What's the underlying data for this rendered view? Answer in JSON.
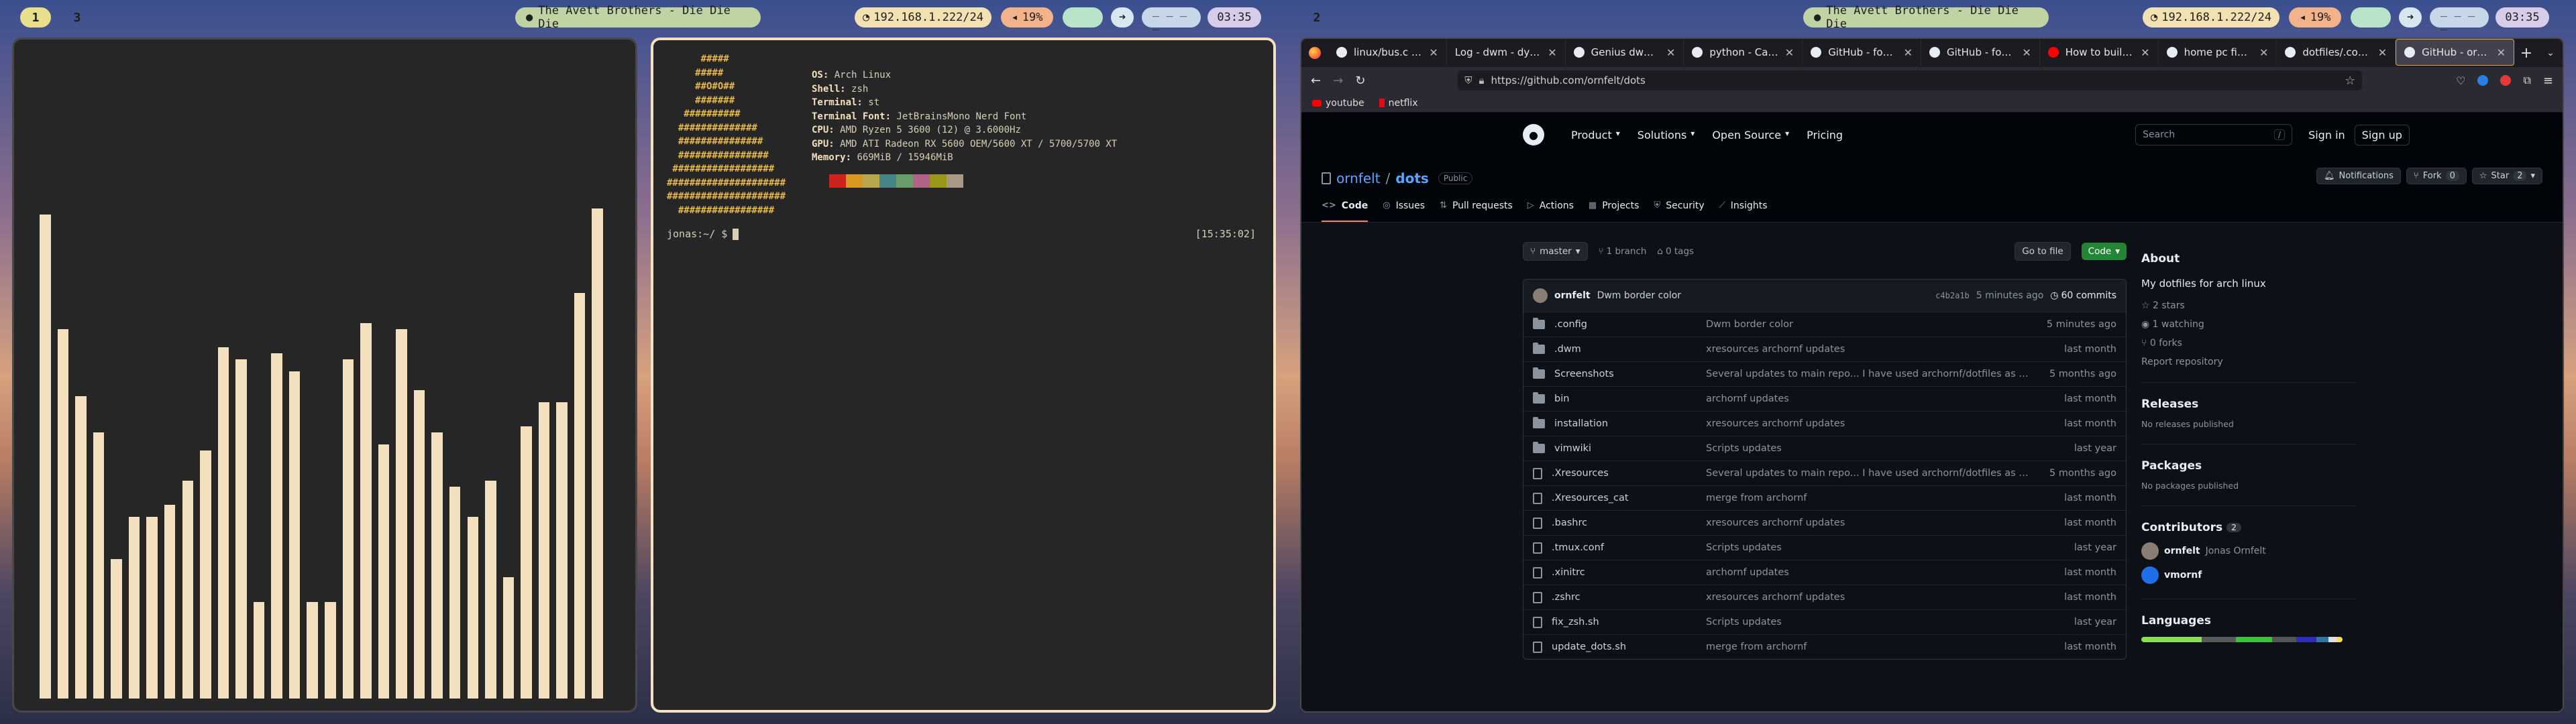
{
  "left_bar": {
    "tags": [
      "1",
      "3"
    ],
    "song": "The Avett Brothers - Die Die Die",
    "ip": "192.168.1.222/24",
    "volume": "19%",
    "dots": "_ _ _ _",
    "time": "03:35"
  },
  "right_bar": {
    "tags": [
      "2"
    ],
    "song": "The Avett Brothers - Die Die Die",
    "ip": "192.168.1.222/24",
    "volume": "19%",
    "dots": "_ _ _ _",
    "time": "03:35"
  },
  "visualizer": {
    "levels": [
      0.8,
      0.61,
      0.5,
      0.44,
      0.23,
      0.3,
      0.3,
      0.32,
      0.36,
      0.41,
      0.58,
      0.56,
      0.16,
      0.57,
      0.54,
      0.16,
      0.16,
      0.56,
      0.62,
      0.42,
      0.61,
      0.51,
      0.44,
      0.35,
      0.3,
      0.36,
      0.2,
      0.45,
      0.49,
      0.49,
      0.67,
      0.81
    ],
    "bar_color": "#f3e0bf"
  },
  "terminal": {
    "logo": [
      "      #####",
      "     #####",
      "     ##O#O##",
      "     #######",
      "   ##########",
      "  ##############",
      "  ###############",
      "  ################",
      " ##################",
      "#####################",
      "#####################",
      "  #################"
    ],
    "info": [
      {
        "key": "OS:",
        "val": "Arch Linux"
      },
      {
        "key": "Shell:",
        "val": "zsh"
      },
      {
        "key": "Terminal:",
        "val": "st"
      },
      {
        "key": "Terminal Font:",
        "val": "JetBrainsMono Nerd Font"
      },
      {
        "key": "CPU:",
        "val": "AMD Ryzen 5 3600 (12) @ 3.6000Hz"
      },
      {
        "key": "GPU:",
        "val": "AMD ATI Radeon RX 5600 OEM/5600 XT / 5700/5700 XT"
      },
      {
        "key": "Memory:",
        "val": "669MiB / 15946MiB"
      }
    ],
    "swatches": [
      "#cc241d",
      "#d79921",
      "#b8a64c",
      "#458588",
      "#689d6a",
      "#b16286",
      "#98971a",
      "#a89984"
    ],
    "prompt": "jonas:~/ $",
    "clock": "[15:35:02]"
  },
  "browser": {
    "tabs": [
      {
        "title": "linux/bus.c at main",
        "icon": "github-icon"
      },
      {
        "title": "Log - dwm - dynamic",
        "icon": "none"
      },
      {
        "title": "Genius dwm single",
        "icon": "github-icon"
      },
      {
        "title": "python - Calling a",
        "icon": "github-icon"
      },
      {
        "title": "GitHub - foglemon",
        "icon": "github-icon"
      },
      {
        "title": "GitHub - foglemon",
        "icon": "github-icon"
      },
      {
        "title": "How to build and",
        "icon": "youtube-icon"
      },
      {
        "title": "home pc fixes - on",
        "icon": "github-icon"
      },
      {
        "title": "dotfiles/.config at",
        "icon": "github-icon"
      },
      {
        "title": "GitHub - ornfelt/do",
        "icon": "github-icon"
      }
    ],
    "url": "https://github.com/ornfelt/dots",
    "bookmarks": [
      "youtube",
      "netflix"
    ]
  },
  "github": {
    "nav": [
      "Product",
      "Solutions",
      "Open Source",
      "Pricing"
    ],
    "search_placeholder": "Search",
    "search_key": "/",
    "sign_in": "Sign in",
    "sign_up": "Sign up",
    "owner": "ornfelt",
    "repo": "dots",
    "visibility": "Public",
    "notifications": "Notifications",
    "fork_label": "Fork",
    "fork_count": "0",
    "star_label": "Star",
    "star_count": "2",
    "repo_tabs": [
      "Code",
      "Issues",
      "Pull requests",
      "Actions",
      "Projects",
      "Security",
      "Insights"
    ],
    "branch": "master",
    "branch_count": "1 branch",
    "tag_count": "0 tags",
    "go_to_file": "Go to file",
    "code_button": "Code",
    "commit": {
      "author": "ornfelt",
      "message": "Dwm border color",
      "hash": "c4b2a1b",
      "time": "5 minutes ago",
      "count": "60 commits"
    },
    "files": [
      {
        "name": ".config",
        "type": "dir",
        "msg": "Dwm border color",
        "time": "5 minutes ago"
      },
      {
        "name": ".dwm",
        "type": "dir",
        "msg": "xresources archornf updates",
        "time": "last month"
      },
      {
        "name": "Screenshots",
        "type": "dir",
        "msg": "Several updates to main repo... I have used archornf/dotfiles as rep...",
        "time": "5 months ago"
      },
      {
        "name": "bin",
        "type": "dir",
        "msg": "archornf updates",
        "time": "last month"
      },
      {
        "name": "installation",
        "type": "dir",
        "msg": "xresources archornf updates",
        "time": "last month"
      },
      {
        "name": "vimwiki",
        "type": "dir",
        "msg": "Scripts updates",
        "time": "last year"
      },
      {
        "name": ".Xresources",
        "type": "file",
        "msg": "Several updates to main repo... I have used archornf/dotfiles as rep...",
        "time": "5 months ago"
      },
      {
        "name": ".Xresources_cat",
        "type": "file",
        "msg": "merge from archornf",
        "time": "last month"
      },
      {
        "name": ".bashrc",
        "type": "file",
        "msg": "xresources archornf updates",
        "time": "last month"
      },
      {
        "name": ".tmux.conf",
        "type": "file",
        "msg": "Scripts updates",
        "time": "last year"
      },
      {
        "name": ".xinitrc",
        "type": "file",
        "msg": "archornf updates",
        "time": "last month"
      },
      {
        "name": ".zshrc",
        "type": "file",
        "msg": "xresources archornf updates",
        "time": "last month"
      },
      {
        "name": "fix_zsh.sh",
        "type": "file",
        "msg": "Scripts updates",
        "time": "last year"
      },
      {
        "name": "update_dots.sh",
        "type": "file",
        "msg": "merge from archornf",
        "time": "last month"
      }
    ],
    "about": {
      "heading": "About",
      "desc": "My dotfiles for arch linux",
      "stars": "2 stars",
      "watching": "1 watching",
      "forks": "0 forks",
      "report": "Report repository",
      "releases_h": "Releases",
      "releases_t": "No releases published",
      "packages_h": "Packages",
      "packages_t": "No packages published",
      "contributors_h": "Contributors",
      "contributors_count": "2",
      "contributors": [
        {
          "login": "ornfelt",
          "name": "Jonas Ornfelt"
        },
        {
          "login": "vmornf",
          "name": ""
        }
      ],
      "languages_h": "Languages",
      "languages": [
        {
          "color": "#89e051",
          "share": 0.3
        },
        {
          "color": "#5a5a5a",
          "share": 0.17
        },
        {
          "color": "#3ac33a",
          "share": 0.18
        },
        {
          "color": "#555555",
          "share": 0.12
        },
        {
          "color": "#2b2bbd",
          "share": 0.1
        },
        {
          "color": "#3572a5",
          "share": 0.06
        },
        {
          "color": "#e0e0e0",
          "share": 0.04
        },
        {
          "color": "#f1e05a",
          "share": 0.03
        }
      ]
    }
  },
  "colors": {
    "accent": "#f3e0bf",
    "gh_bg": "#0d1117",
    "link": "#58a6ff",
    "green": "#238636"
  }
}
